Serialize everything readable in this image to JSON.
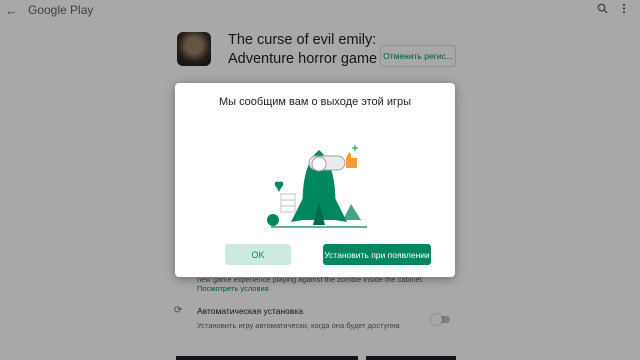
{
  "appbar": {
    "title": "Google Play",
    "back_icon": "arrow-left-icon",
    "icons": [
      "search-icon",
      "more-vert-icon"
    ]
  },
  "app": {
    "title": "The curse of evil emily: Adventure horror game",
    "cancel_label": "Отменить регис..."
  },
  "background": {
    "description": "new game experience playing against the zombie inside the cabinet.",
    "terms_link": "Посмотреть условия",
    "auto_install": {
      "title": "Автоматическая установка",
      "subtitle": "Установить игру автоматически, когда она будет доступна",
      "enabled": false
    }
  },
  "dialog": {
    "title": "Мы сообщим вам о выходе этой игры",
    "ok_label": "OK",
    "install_label": "Установить при появлении"
  },
  "colors": {
    "accent": "#01875f",
    "accent_light": "#ceeadf",
    "illustration_orange": "#f29c38"
  }
}
